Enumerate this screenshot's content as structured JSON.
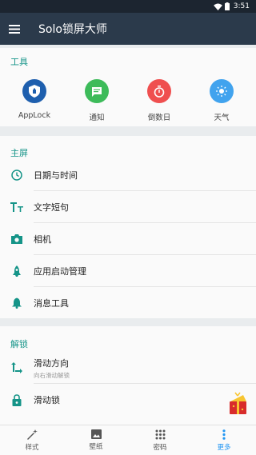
{
  "status": {
    "time": "3:51"
  },
  "appbar": {
    "title": "Solo锁屏大师"
  },
  "tools": {
    "title": "工具",
    "items": [
      {
        "label": "AppLock",
        "color": "#1e5fae"
      },
      {
        "label": "通知",
        "color": "#3dbb5a"
      },
      {
        "label": "倒数日",
        "color": "#ef4f4f"
      },
      {
        "label": "天气",
        "color": "#41a3ee"
      }
    ]
  },
  "home": {
    "title": "主屏",
    "items": [
      {
        "label": "日期与时间"
      },
      {
        "label": "文字短句"
      },
      {
        "label": "相机"
      },
      {
        "label": "应用启动管理"
      },
      {
        "label": "消息工具"
      }
    ]
  },
  "unlock": {
    "title": "解锁",
    "items": [
      {
        "label": "滑动方向",
        "sub": "向右滑动解锁"
      },
      {
        "label": "滑动锁"
      }
    ]
  },
  "tabs": [
    {
      "label": "样式"
    },
    {
      "label": "壁纸"
    },
    {
      "label": "密码"
    },
    {
      "label": "更多"
    }
  ],
  "colors": {
    "accent": "#159488",
    "active_tab": "#2196f3",
    "appbar": "#2b3a4b"
  }
}
